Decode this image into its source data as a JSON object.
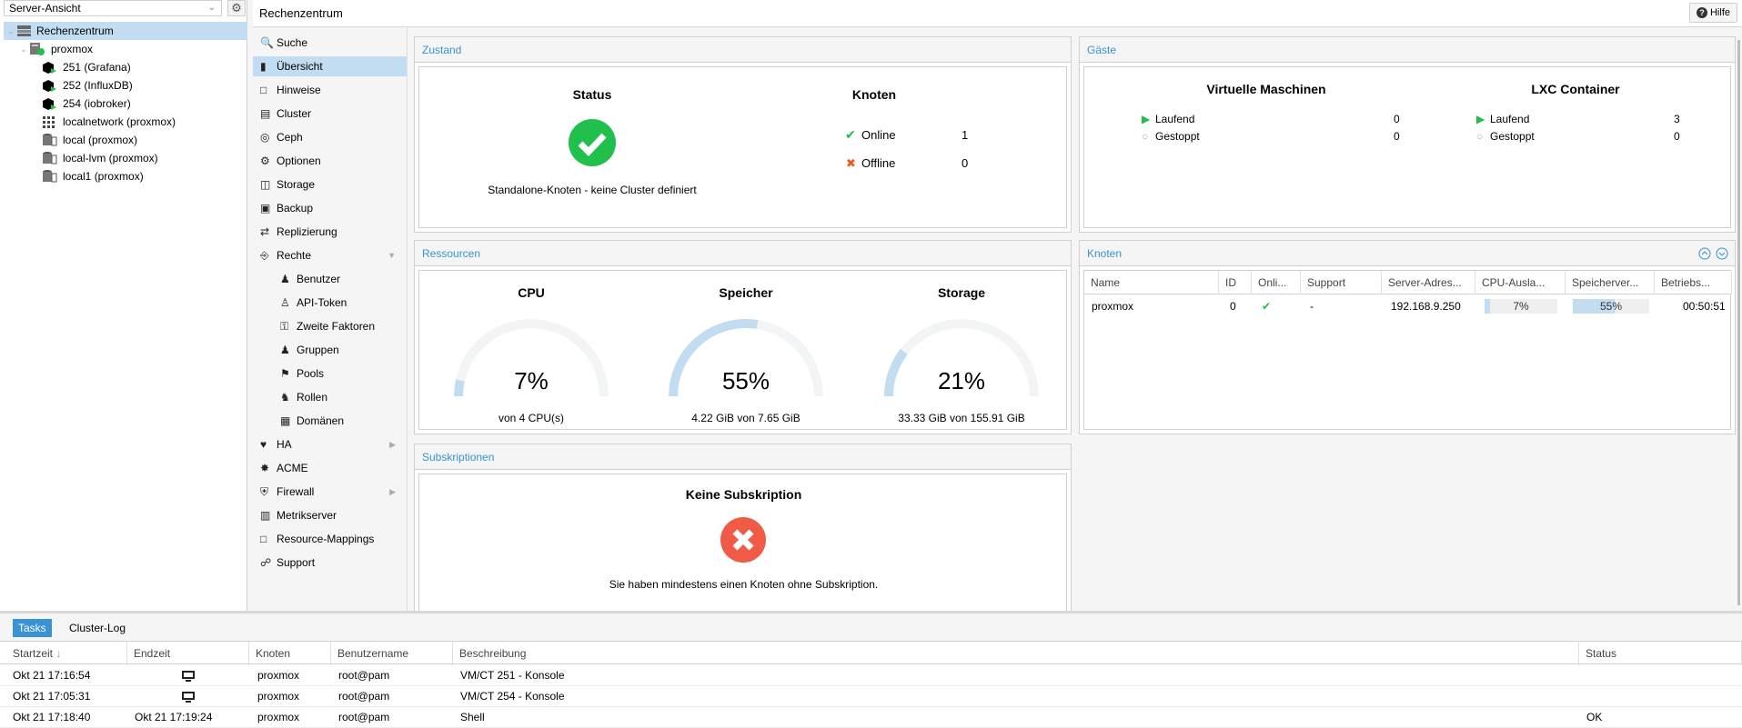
{
  "tree": {
    "view_select": "Server-Ansicht",
    "items": [
      {
        "label": "Rechenzentrum"
      },
      {
        "label": "proxmox"
      },
      {
        "label": "251 (Grafana)"
      },
      {
        "label": "252 (InfluxDB)"
      },
      {
        "label": "254 (iobroker)"
      },
      {
        "label": "localnetwork (proxmox)"
      },
      {
        "label": "local (proxmox)"
      },
      {
        "label": "local-lvm (proxmox)"
      },
      {
        "label": "local1 (proxmox)"
      }
    ]
  },
  "header": {
    "title": "Rechenzentrum",
    "help_label": "Hilfe"
  },
  "menu": {
    "items": [
      {
        "label": "Suche",
        "icon": "search-icon"
      },
      {
        "label": "Übersicht",
        "icon": "book-icon"
      },
      {
        "label": "Hinweise",
        "icon": "note-icon"
      },
      {
        "label": "Cluster",
        "icon": "server-icon"
      },
      {
        "label": "Ceph",
        "icon": "ceph-icon"
      },
      {
        "label": "Optionen",
        "icon": "gear-icon"
      },
      {
        "label": "Storage",
        "icon": "database-icon"
      },
      {
        "label": "Backup",
        "icon": "floppy-icon"
      },
      {
        "label": "Replizierung",
        "icon": "retweet-icon"
      },
      {
        "label": "Rechte",
        "icon": "unlock-icon"
      },
      {
        "label": "Benutzer",
        "icon": "user-icon"
      },
      {
        "label": "API-Token",
        "icon": "user-outline-icon"
      },
      {
        "label": "Zweite Faktoren",
        "icon": "key-icon"
      },
      {
        "label": "Gruppen",
        "icon": "users-icon"
      },
      {
        "label": "Pools",
        "icon": "tags-icon"
      },
      {
        "label": "Rollen",
        "icon": "male-icon"
      },
      {
        "label": "Domänen",
        "icon": "address-book-icon"
      },
      {
        "label": "HA",
        "icon": "heartbeat-icon"
      },
      {
        "label": "ACME",
        "icon": "certificate-icon"
      },
      {
        "label": "Firewall",
        "icon": "shield-icon"
      },
      {
        "label": "Metrikserver",
        "icon": "bar-chart-icon"
      },
      {
        "label": "Resource-Mappings",
        "icon": "folder-icon"
      },
      {
        "label": "Support",
        "icon": "comments-icon"
      }
    ]
  },
  "zustand": {
    "title": "Zustand",
    "status_heading": "Status",
    "status_text": "Standalone-Knoten - keine Cluster definiert",
    "knoten_heading": "Knoten",
    "online_label": "Online",
    "online_value": "1",
    "offline_label": "Offline",
    "offline_value": "0"
  },
  "gaeste": {
    "title": "Gäste",
    "vm_heading": "Virtuelle Maschinen",
    "lxc_heading": "LXC Container",
    "running_label": "Laufend",
    "stopped_label": "Gestoppt",
    "vm_running": "0",
    "vm_stopped": "0",
    "lxc_running": "3",
    "lxc_stopped": "0"
  },
  "ressourcen": {
    "title": "Ressourcen",
    "gauges": [
      {
        "label": "CPU",
        "value": "7%",
        "fraction": 0.07,
        "sub": "von 4 CPU(s)"
      },
      {
        "label": "Speicher",
        "value": "55%",
        "fraction": 0.55,
        "sub": "4.22 GiB von 7.65 GiB"
      },
      {
        "label": "Storage",
        "value": "21%",
        "fraction": 0.21,
        "sub": "33.33 GiB von 155.91 GiB"
      }
    ]
  },
  "knoten": {
    "title": "Knoten",
    "columns": [
      "Name",
      "ID",
      "Onli...",
      "Support",
      "Server-Adres...",
      "CPU-Ausla...",
      "Speicherver...",
      "Betriebs..."
    ],
    "row": {
      "name": "proxmox",
      "id": "0",
      "support": "-",
      "address": "192.168.9.250",
      "cpu": "7%",
      "cpu_fraction": 0.07,
      "mem": "55%",
      "mem_fraction": 0.55,
      "uptime": "00:50:51"
    }
  },
  "subskriptionen": {
    "title": "Subskriptionen",
    "heading": "Keine Subskription",
    "text": "Sie haben mindestens einen Knoten ohne Subskription."
  },
  "tasks": {
    "tab_tasks": "Tasks",
    "tab_log": "Cluster-Log",
    "columns": [
      "Startzeit",
      "Endzeit",
      "Knoten",
      "Benutzername",
      "Beschreibung",
      "Status"
    ],
    "rows": [
      {
        "start": "Okt 21 17:16:54",
        "end": "",
        "node": "proxmox",
        "user": "root@pam",
        "desc": "VM/CT 251 - Konsole",
        "status": ""
      },
      {
        "start": "Okt 21 17:05:31",
        "end": "",
        "node": "proxmox",
        "user": "root@pam",
        "desc": "VM/CT 254 - Konsole",
        "status": ""
      },
      {
        "start": "Okt 21 17:18:40",
        "end": "Okt 21 17:19:24",
        "node": "proxmox",
        "user": "root@pam",
        "desc": "Shell",
        "status": "OK"
      }
    ]
  }
}
